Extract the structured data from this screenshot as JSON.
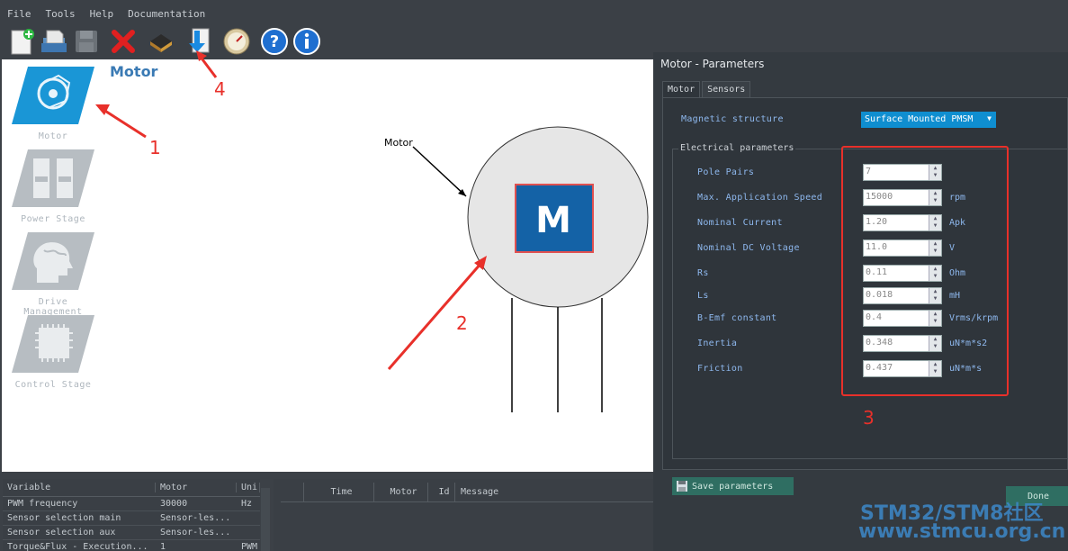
{
  "menu": {
    "items": [
      "File",
      "Tools",
      "Help",
      "Documentation"
    ]
  },
  "toolbar": {
    "icons": [
      "new-project-icon",
      "open-project-icon",
      "save-project-icon",
      "close-project-icon",
      "chip-icon",
      "generate-icon",
      "monitor-gauge-icon",
      "help-icon",
      "info-icon"
    ]
  },
  "sidebar": {
    "items": [
      {
        "label": "Motor",
        "icon": "motor-icon"
      },
      {
        "label": "Power Stage",
        "icon": "battery-icon"
      },
      {
        "label": "Drive Management",
        "icon": "brain-head-icon"
      },
      {
        "label": "Control Stage",
        "icon": "microcontroller-icon"
      }
    ]
  },
  "diagram": {
    "title": "Motor",
    "annotation": "Motor",
    "block": "M"
  },
  "variables": {
    "headers": [
      "Variable",
      "Motor",
      "Uni"
    ],
    "rows": [
      [
        "PWM frequency",
        "30000",
        "Hz"
      ],
      [
        "Sensor selection main",
        "Sensor-les...",
        ""
      ],
      [
        "Sensor selection aux",
        "Sensor-les...",
        ""
      ],
      [
        "Torque&Flux - Execution...",
        "1",
        "PWM"
      ]
    ]
  },
  "messages": {
    "headers": [
      "",
      "Time",
      "Motor",
      "Id",
      "Message"
    ]
  },
  "dialog": {
    "title": "Motor - Parameters",
    "tabs": [
      "Motor",
      "Sensors"
    ],
    "magnetic": {
      "label": "Magnetic structure",
      "value": "Surface Mounted PMSM"
    },
    "group_title": "Electrical parameters",
    "params": [
      {
        "label": "Pole Pairs",
        "value": "7",
        "unit": ""
      },
      {
        "label": "Max. Application Speed",
        "value": "15000",
        "unit": "rpm"
      },
      {
        "label": "Nominal Current",
        "value": "1.20",
        "unit": "Apk"
      },
      {
        "label": "Nominal DC Voltage",
        "value": "11.0",
        "unit": "V"
      },
      {
        "label": "Rs",
        "value": "0.11",
        "unit": "Ohm"
      },
      {
        "label": "Ls",
        "value": "0.018",
        "unit": "mH"
      },
      {
        "label": "B-Emf constant",
        "value": "0.4",
        "unit": "Vrms/krpm"
      },
      {
        "label": "Inertia",
        "value": "0.348",
        "unit": "uN*m*s2"
      },
      {
        "label": "Friction",
        "value": "0.437",
        "unit": "uN*m*s"
      }
    ],
    "save_label": "Save parameters",
    "done_label": "Done"
  },
  "annotations": [
    "1",
    "2",
    "3",
    "4"
  ],
  "watermark": {
    "line1": "STM32/STM8社区",
    "line2": "www.stmcu.org.cn"
  },
  "colors": {
    "accent": "#0f8ed0",
    "annotation": "#e8302a",
    "motor_block": "#1462a6"
  }
}
